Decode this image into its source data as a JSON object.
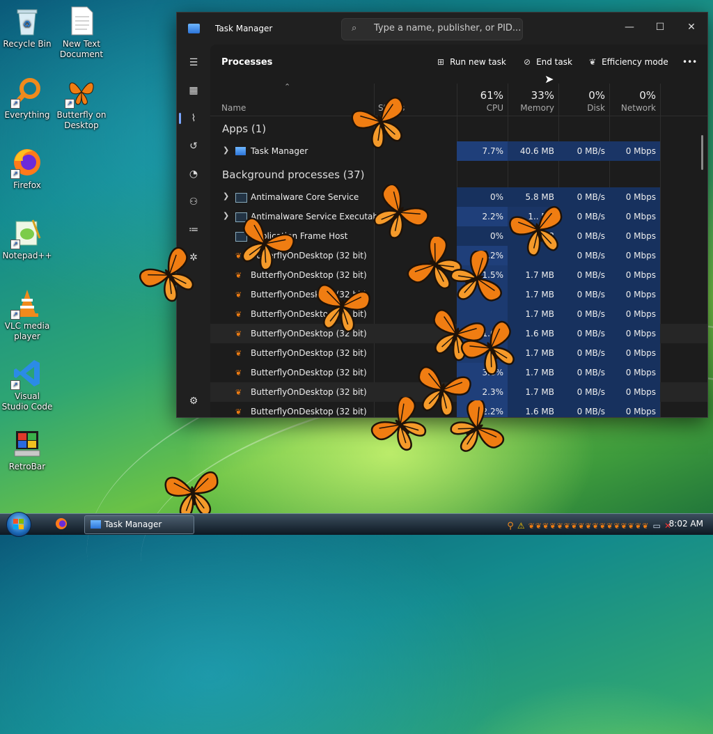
{
  "desktop": {
    "icons": [
      {
        "label": "Recycle Bin"
      },
      {
        "label": "New Text Document"
      },
      {
        "label": "Everything"
      },
      {
        "label": "Butterfly on Desktop"
      },
      {
        "label": "Firefox"
      },
      {
        "label": "Notepad++"
      },
      {
        "label": "VLC media player"
      },
      {
        "label": "Visual Studio Code"
      },
      {
        "label": "RetroBar"
      }
    ]
  },
  "window": {
    "title": "Task Manager",
    "search_placeholder": "Type a name, publisher, or PID..."
  },
  "toolbar": {
    "page_title": "Processes",
    "run_new_task": "Run new task",
    "end_task": "End task",
    "efficiency_mode": "Efficiency mode"
  },
  "columns": {
    "name": "Name",
    "status": "Status",
    "cpu_pct": "61%",
    "cpu": "CPU",
    "memory_pct": "33%",
    "memory": "Memory",
    "disk_pct": "0%",
    "disk": "Disk",
    "network_pct": "0%",
    "network": "Network"
  },
  "groups": {
    "apps": "Apps (1)",
    "background": "Background processes (37)"
  },
  "processes": [
    {
      "name": "Task Manager",
      "cpu": "7.7%",
      "memory": "40.6 MB",
      "disk": "0 MB/s",
      "network": "0 Mbps"
    },
    {
      "name": "Antimalware Core Service",
      "cpu": "0%",
      "memory": "5.8 MB",
      "disk": "0 MB/s",
      "network": "0 Mbps"
    },
    {
      "name": "Antimalware Service Executable",
      "cpu": "2.2%",
      "memory": "1.. MB",
      "disk": "0 MB/s",
      "network": "0 Mbps"
    },
    {
      "name": "Application Frame Host",
      "cpu": "0%",
      "memory": "MB",
      "disk": "0 MB/s",
      "network": "0 Mbps"
    },
    {
      "name": "ButterflyOnDesktop (32 bit)",
      "cpu": "2.2%",
      "memory": "",
      "disk": "0 MB/s",
      "network": "0 Mbps"
    },
    {
      "name": "ButterflyOnDesktop (32 bit)",
      "cpu": "1.5%",
      "memory": "1.7 MB",
      "disk": "0 MB/s",
      "network": "0 Mbps"
    },
    {
      "name": "ButterflyOnDesktop (32 bit)",
      "cpu": "",
      "memory": "1.7 MB",
      "disk": "0 MB/s",
      "network": "0 Mbps"
    },
    {
      "name": "ButterflyOnDesktop (32 bit)",
      "cpu": "",
      "memory": "1.7 MB",
      "disk": "0 MB/s",
      "network": "0 Mbps"
    },
    {
      "name": "ButterflyOnDesktop (32 bit)",
      "cpu": "1.6%",
      "memory": "1.6 MB",
      "disk": "0 MB/s",
      "network": "0 Mbps"
    },
    {
      "name": "ButterflyOnDesktop (32 bit)",
      "cpu": "",
      "memory": "1.7 MB",
      "disk": "0 MB/s",
      "network": "0 Mbps"
    },
    {
      "name": "ButterflyOnDesktop (32 bit)",
      "cpu": "3.8%",
      "memory": "1.7 MB",
      "disk": "0 MB/s",
      "network": "0 Mbps"
    },
    {
      "name": "ButterflyOnDesktop (32 bit)",
      "cpu": "2.3%",
      "memory": "1.7 MB",
      "disk": "0 MB/s",
      "network": "0 Mbps"
    },
    {
      "name": "ButterflyOnDesktop (32 bit)",
      "cpu": "2.2%",
      "memory": "1.6 MB",
      "disk": "0 MB/s",
      "network": "0 Mbps"
    }
  ],
  "taskbar": {
    "task_label": "Task Manager",
    "clock": "8:02 AM"
  }
}
